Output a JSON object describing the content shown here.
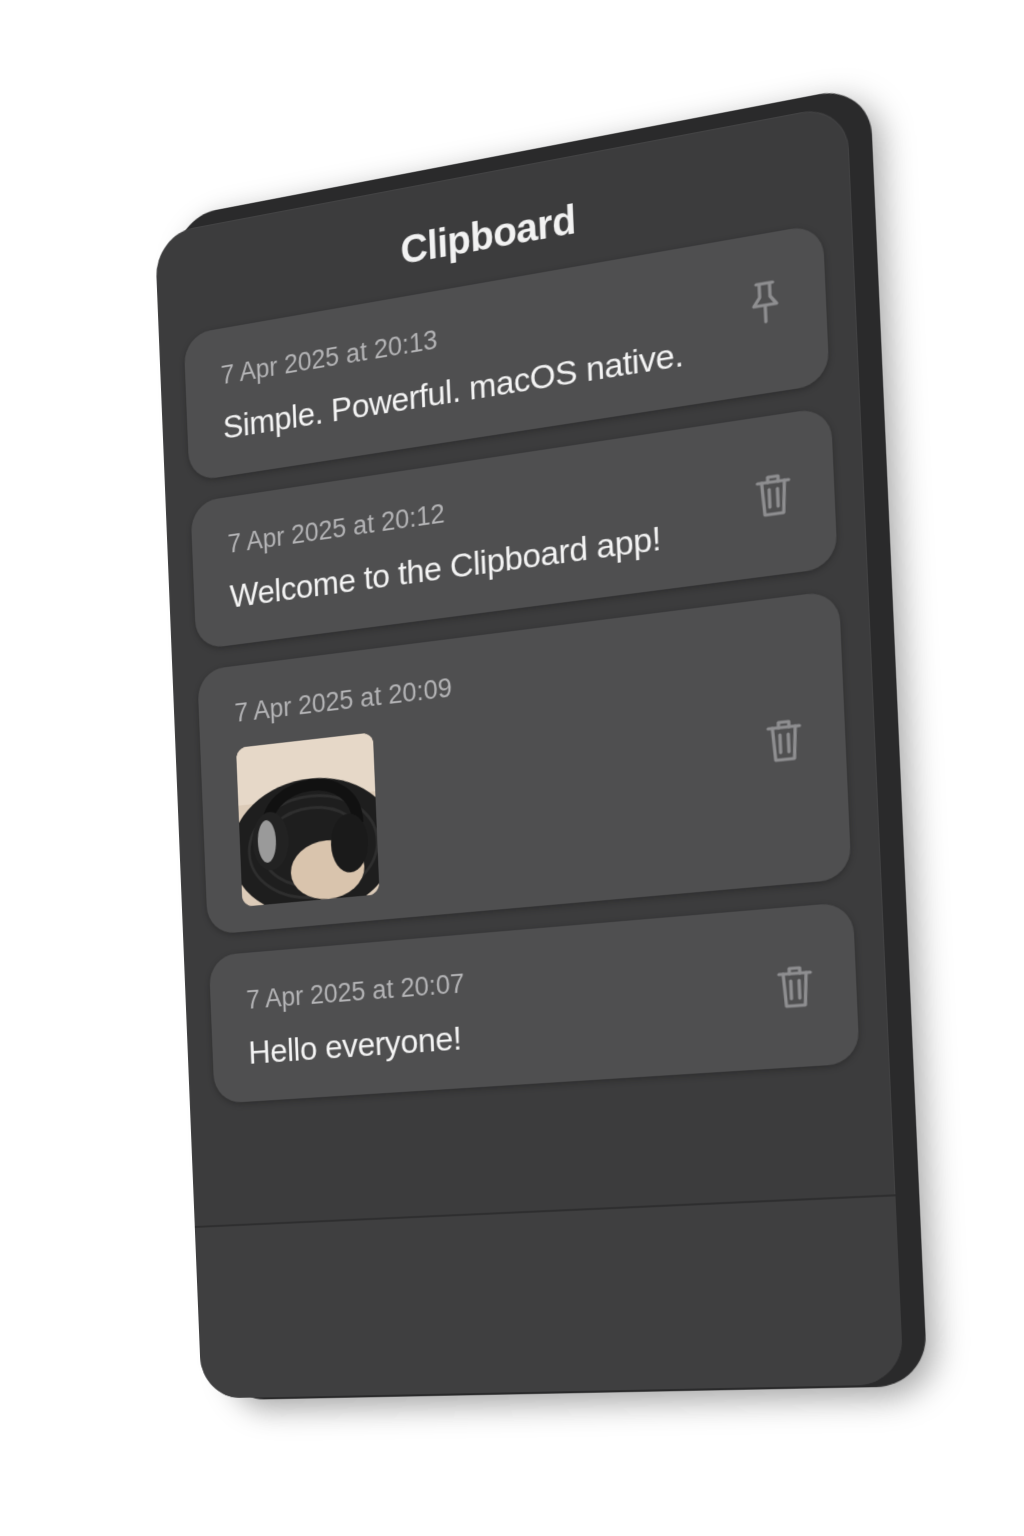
{
  "app": {
    "title": "Clipboard"
  },
  "items": [
    {
      "timestamp": "7 Apr 2025 at 20:13",
      "text": "Simple. Powerful. macOS native.",
      "kind": "text",
      "action_icon": "pin-icon"
    },
    {
      "timestamp": "7 Apr 2025 at 20:12",
      "text": "Welcome to the Clipboard app!",
      "kind": "text",
      "action_icon": "trash-icon"
    },
    {
      "timestamp": "7 Apr 2025 at 20:09",
      "kind": "image",
      "image_subject": "headphones-thumbnail",
      "action_icon": "trash-icon"
    },
    {
      "timestamp": "7 Apr 2025 at 20:07",
      "text": "Hello everyone!",
      "kind": "text",
      "action_icon": "trash-icon"
    }
  ],
  "colors": {
    "background": "#3c3c3d",
    "card": "#4f4f50",
    "text_primary": "#f4f4f4",
    "text_secondary": "#b4b4b6",
    "icon": "#8e8e90"
  }
}
